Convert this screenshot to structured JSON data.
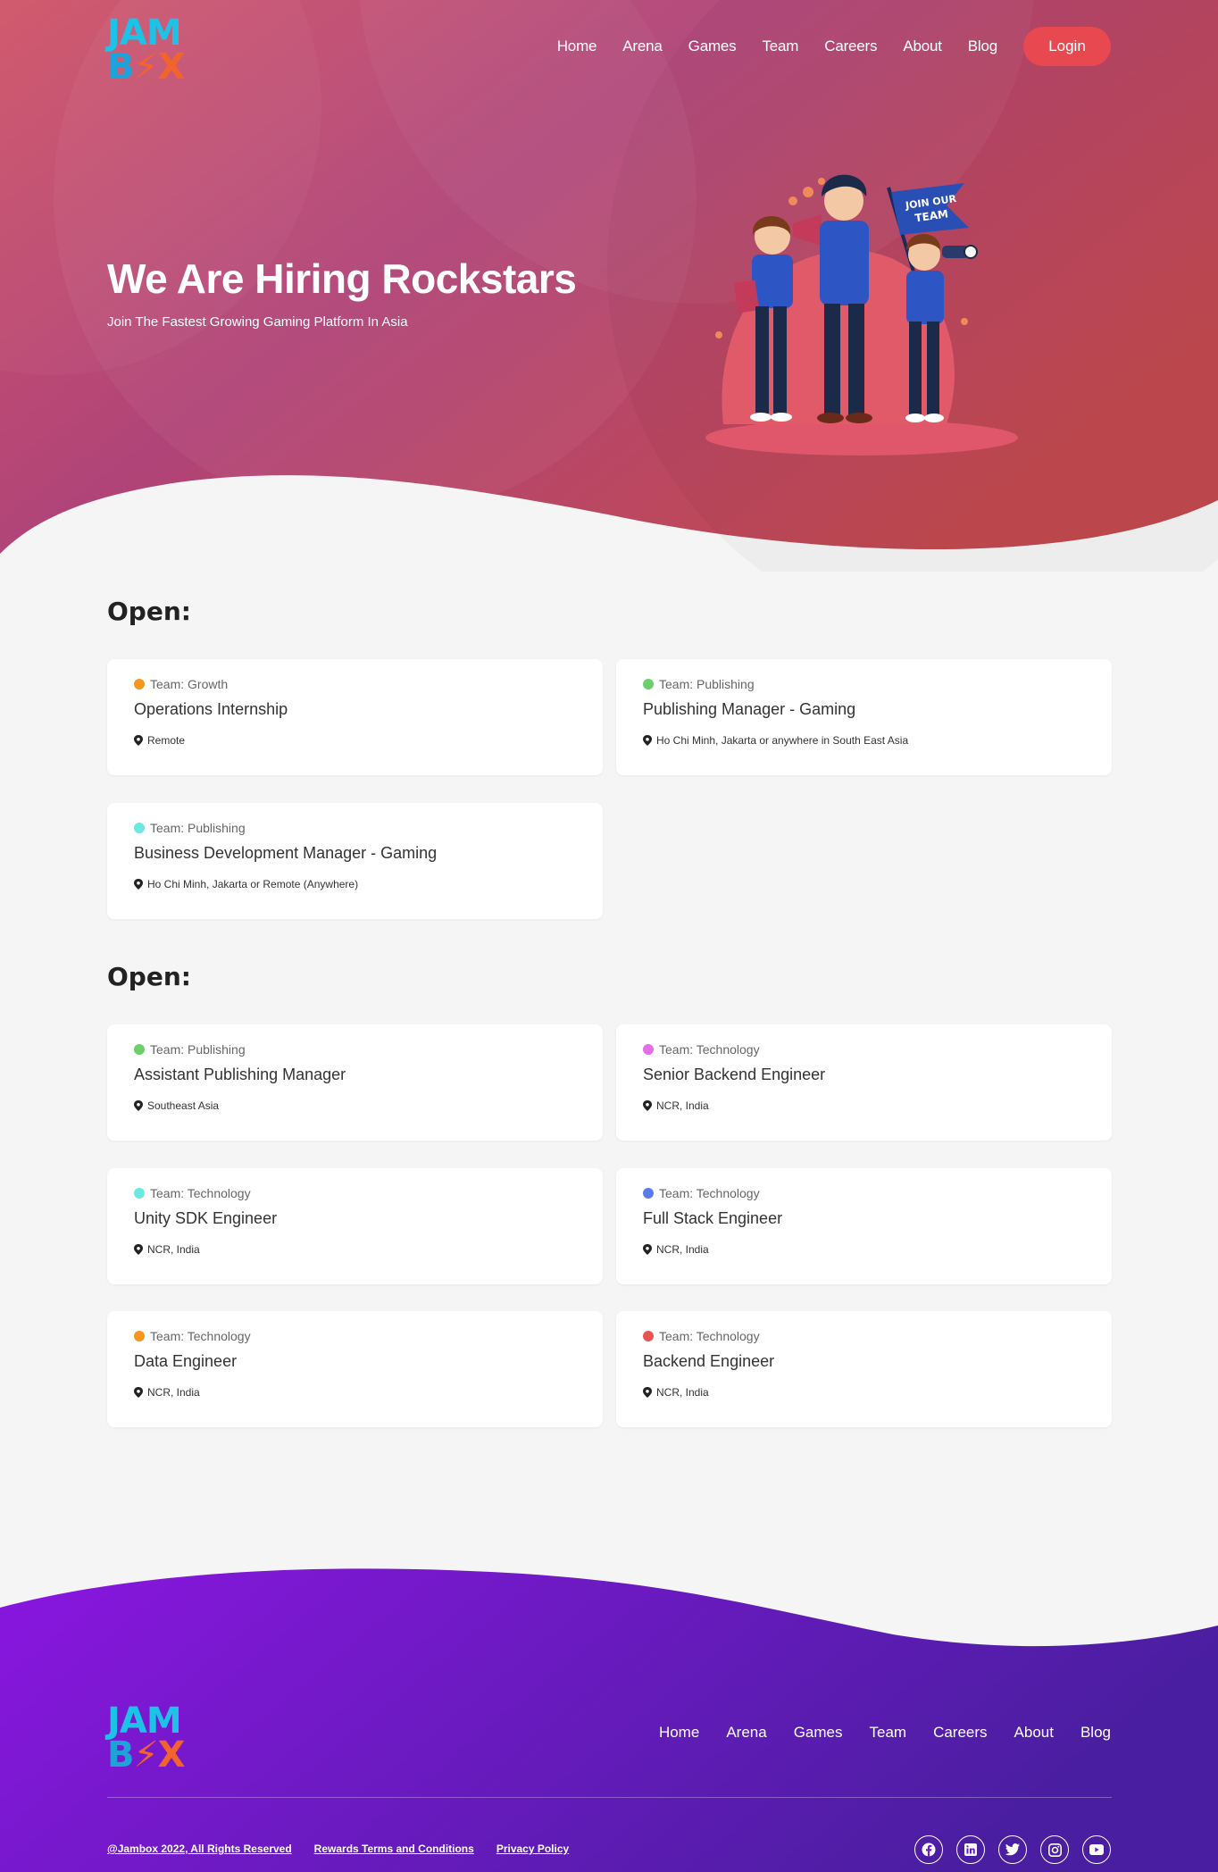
{
  "brand": {
    "logo_top": "JAM",
    "logo_bottom_b": "B",
    "logo_bottom_o": "⚡",
    "logo_bottom_x": "X"
  },
  "nav": {
    "items": [
      "Home",
      "Arena",
      "Games",
      "Team",
      "Careers",
      "About",
      "Blog"
    ],
    "login": "Login"
  },
  "hero": {
    "title": "We Are Hiring Rockstars",
    "subtitle": "Join The Fastest Growing Gaming Platform In Asia",
    "flag_text": "JOIN OUR TEAM"
  },
  "sections": [
    {
      "title": "Open:",
      "jobs": [
        {
          "team": "Team: Growth",
          "dot": "#f5961f",
          "title": "Operations Internship",
          "location": "Remote"
        },
        {
          "team": "Team: Publishing",
          "dot": "#6ccf6a",
          "title": "Publishing Manager - Gaming",
          "location": "Ho Chi Minh, Jakarta or anywhere in South East Asia"
        },
        {
          "team": "Team: Publishing",
          "dot": "#6be8e0",
          "title": "Business Development Manager - Gaming",
          "location": "Ho Chi Minh, Jakarta or Remote (Anywhere)"
        }
      ]
    },
    {
      "title": "Open:",
      "jobs": [
        {
          "team": "Team: Publishing",
          "dot": "#6ccf6a",
          "title": "Assistant Publishing Manager",
          "location": "Southeast Asia"
        },
        {
          "team": "Team: Technology",
          "dot": "#e56ee8",
          "title": "Senior Backend Engineer",
          "location": "NCR, India"
        },
        {
          "team": "Team: Technology",
          "dot": "#6be8e0",
          "title": "Unity SDK Engineer",
          "location": "NCR, India"
        },
        {
          "team": "Team: Technology",
          "dot": "#5b7be8",
          "title": "Full Stack Engineer",
          "location": "NCR, India"
        },
        {
          "team": "Team: Technology",
          "dot": "#f5961f",
          "title": "Data Engineer",
          "location": "NCR, India"
        },
        {
          "team": "Team: Technology",
          "dot": "#e85454",
          "title": "Backend Engineer",
          "location": "NCR, India"
        }
      ]
    }
  ],
  "footer": {
    "nav": [
      "Home",
      "Arena",
      "Games",
      "Team",
      "Careers",
      "About",
      "Blog"
    ],
    "copyright": "@Jambox 2022, All Rights Reserved",
    "rewards": "Rewards Terms and Conditions",
    "privacy": "Privacy Policy",
    "socials": [
      "facebook-icon",
      "linkedin-icon",
      "twitter-icon",
      "instagram-icon",
      "youtube-icon"
    ]
  },
  "colors": {
    "hero_start": "#c8485f",
    "hero_end": "#b2467a",
    "accent": "#e8484f",
    "footer_start": "#8a16e0",
    "footer_end": "#4a1ea0"
  }
}
